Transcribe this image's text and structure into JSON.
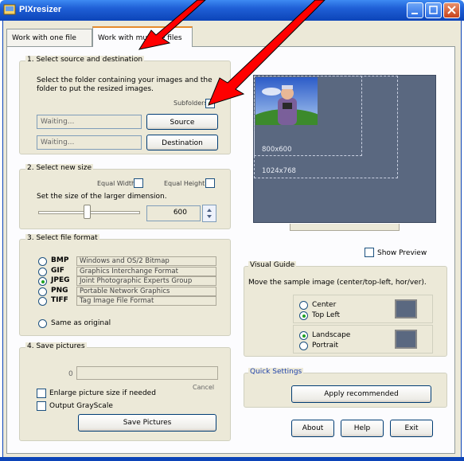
{
  "window": {
    "title": "PIXresizer"
  },
  "tabs": [
    {
      "label": "Work with one file",
      "active": false
    },
    {
      "label": "Work with multiple files",
      "active": true
    }
  ],
  "source_dest": {
    "legend": "1. Select source and destination",
    "instruction": "Select the folder containing your images and the folder to put the resized images.",
    "subfolders_label": "Subfolders",
    "subfolders_checked": true,
    "source_value": "Waiting...",
    "dest_value": "Waiting...",
    "source_button": "Source",
    "dest_button": "Destination"
  },
  "size": {
    "legend": "2. Select new size",
    "equal_width_label": "Equal Width",
    "equal_height_label": "Equal Height",
    "instruction": "Set the size of the larger dimension.",
    "value": "600",
    "slider_fraction": 0.48
  },
  "format": {
    "legend": "3. Select file format",
    "options": [
      {
        "name": "BMP",
        "desc": "Windows and OS/2 Bitmap",
        "checked": false
      },
      {
        "name": "GIF",
        "desc": "Graphics Interchange Format",
        "checked": false
      },
      {
        "name": "JPEG",
        "desc": "Joint Photographic Experts Group",
        "checked": true
      },
      {
        "name": "PNG",
        "desc": "Portable Network Graphics",
        "checked": false
      },
      {
        "name": "TIFF",
        "desc": "Tag Image File Format",
        "checked": false
      }
    ],
    "same_as_original": "Same as original"
  },
  "save": {
    "legend": "4. Save pictures",
    "progress_count": "0",
    "cancel_label": "Cancel",
    "enlarge_label": "Enlarge picture size if needed",
    "grayscale_label": "Output GrayScale",
    "save_button": "Save Pictures"
  },
  "preview": {
    "res1": "800x600",
    "res2": "1024x768",
    "show_preview_label": "Show Preview"
  },
  "visual_guide": {
    "legend": "Visual Guide",
    "instruction": "Move the sample image (center/top-left, hor/ver).",
    "center_label": "Center",
    "topleft_label": "Top Left",
    "landscape_label": "Landscape",
    "portrait_label": "Portrait"
  },
  "quick": {
    "legend": "Quick Settings",
    "apply_button": "Apply recommended"
  },
  "footer": {
    "about": "About",
    "help": "Help",
    "exit": "Exit"
  },
  "colors": {
    "title_blue": "#0c44b8",
    "window_bg": "#ece9d8",
    "preview_bg": "#5a6880",
    "accent_red": "#ff0000",
    "radio_green": "#21a121"
  }
}
